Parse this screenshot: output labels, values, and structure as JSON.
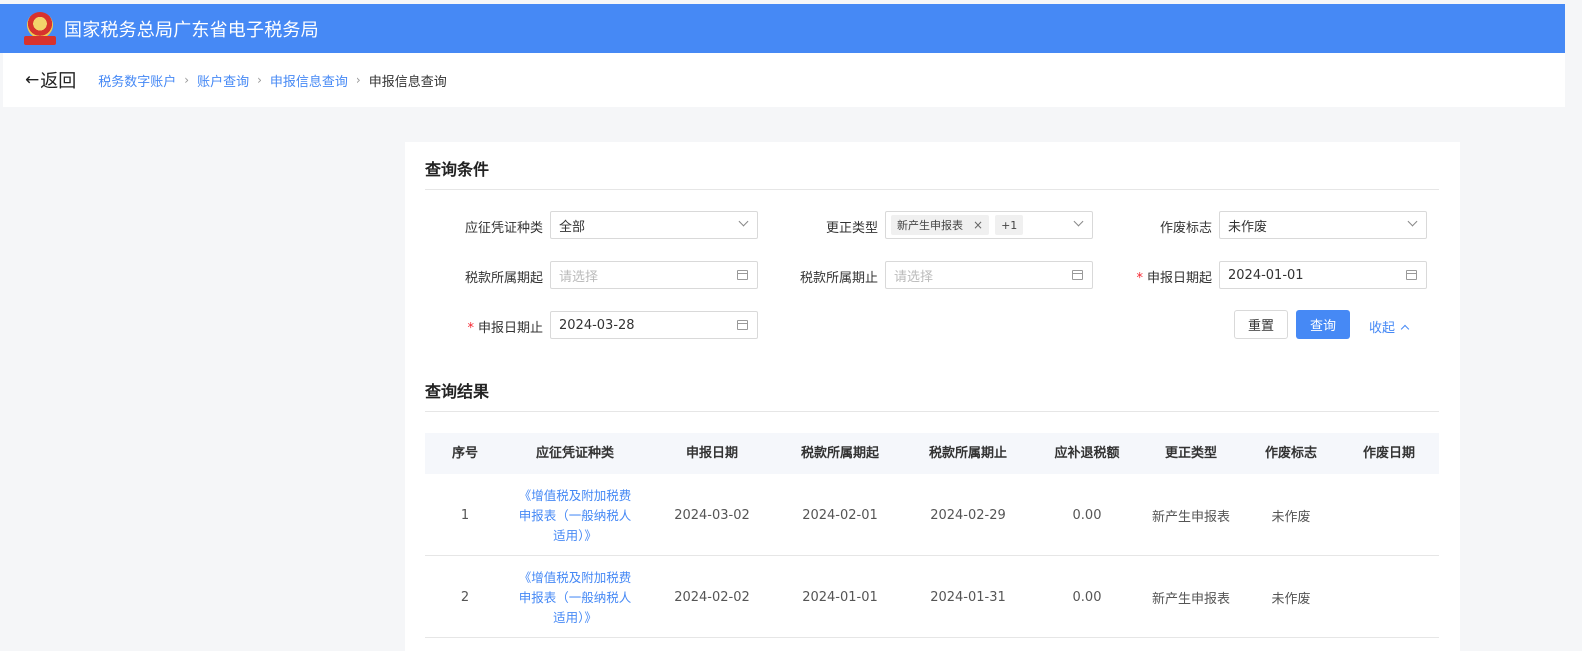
{
  "header": {
    "title": "国家税务总局广东省电子税务局"
  },
  "nav": {
    "back_arrow": "←",
    "back_label": "返回",
    "breadcrumbs": [
      "税务数字账户",
      "账户查询",
      "申报信息查询",
      "申报信息查询"
    ],
    "separator": "›"
  },
  "query": {
    "title": "查询条件",
    "fields": [
      {
        "label": "应征凭证种类",
        "value": "全部",
        "kind": "select"
      },
      {
        "label": "更正类型",
        "value": "",
        "kind": "select",
        "tags": [
          "新产生申报表"
        ],
        "more": "+1"
      },
      {
        "label": "作废标志",
        "value": "未作废",
        "kind": "select"
      },
      {
        "label": "税款所属期起",
        "placeholder": "请选择",
        "kind": "date"
      },
      {
        "label": "税款所属期止",
        "placeholder": "请选择",
        "kind": "date"
      },
      {
        "label": "申报日期起",
        "value": "2024-01-01",
        "kind": "date",
        "required": true
      },
      {
        "label": "申报日期止",
        "value": "2024-03-28",
        "kind": "date",
        "required": true
      }
    ],
    "required_mark": "*",
    "tag_close": "×",
    "reset_label": "重置",
    "query_label": "查询",
    "collapse_label": "收起"
  },
  "results": {
    "title": "查询结果",
    "columns": [
      "序号",
      "应征凭证种类",
      "申报日期",
      "税款所属期起",
      "税款所属期止",
      "应补退税额",
      "更正类型",
      "作废标志",
      "作废日期"
    ],
    "rows": [
      {
        "no": "1",
        "doc": [
          "《增值税及附加税费",
          "申报表（一般纳税人",
          "适用）》"
        ],
        "date": "2024-03-02",
        "start": "2024-02-01",
        "end": "2024-02-29",
        "amount": "0.00",
        "type": "新产生申报表",
        "status": "未作废",
        "void_date": ""
      },
      {
        "no": "2",
        "doc": [
          "《增值税及附加税费",
          "申报表（一般纳税人",
          "适用）》"
        ],
        "date": "2024-02-02",
        "start": "2024-01-01",
        "end": "2024-01-31",
        "amount": "0.00",
        "type": "新产生申报表",
        "status": "未作废",
        "void_date": ""
      }
    ]
  },
  "colors": {
    "primary": "#4689f5",
    "required": "#f5222d",
    "background": "#f5f6f8"
  }
}
